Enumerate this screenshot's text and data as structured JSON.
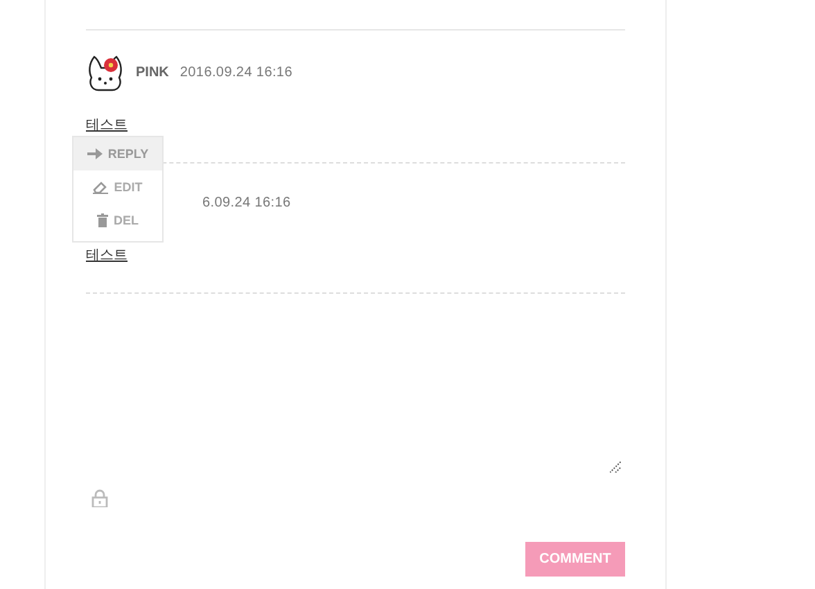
{
  "comments": [
    {
      "author": "PINK",
      "date": "2016.09.24 16:16",
      "text": "테스트"
    },
    {
      "date": "6.09.24 16:16",
      "text": "테스트"
    }
  ],
  "menu": {
    "items": [
      {
        "kind": "reply",
        "label": "REPLY",
        "selected": true
      },
      {
        "kind": "edit",
        "label": "EDIT",
        "selected": false
      },
      {
        "kind": "delete",
        "label": "DEL",
        "selected": false
      }
    ]
  },
  "comment_button": "COMMENT"
}
